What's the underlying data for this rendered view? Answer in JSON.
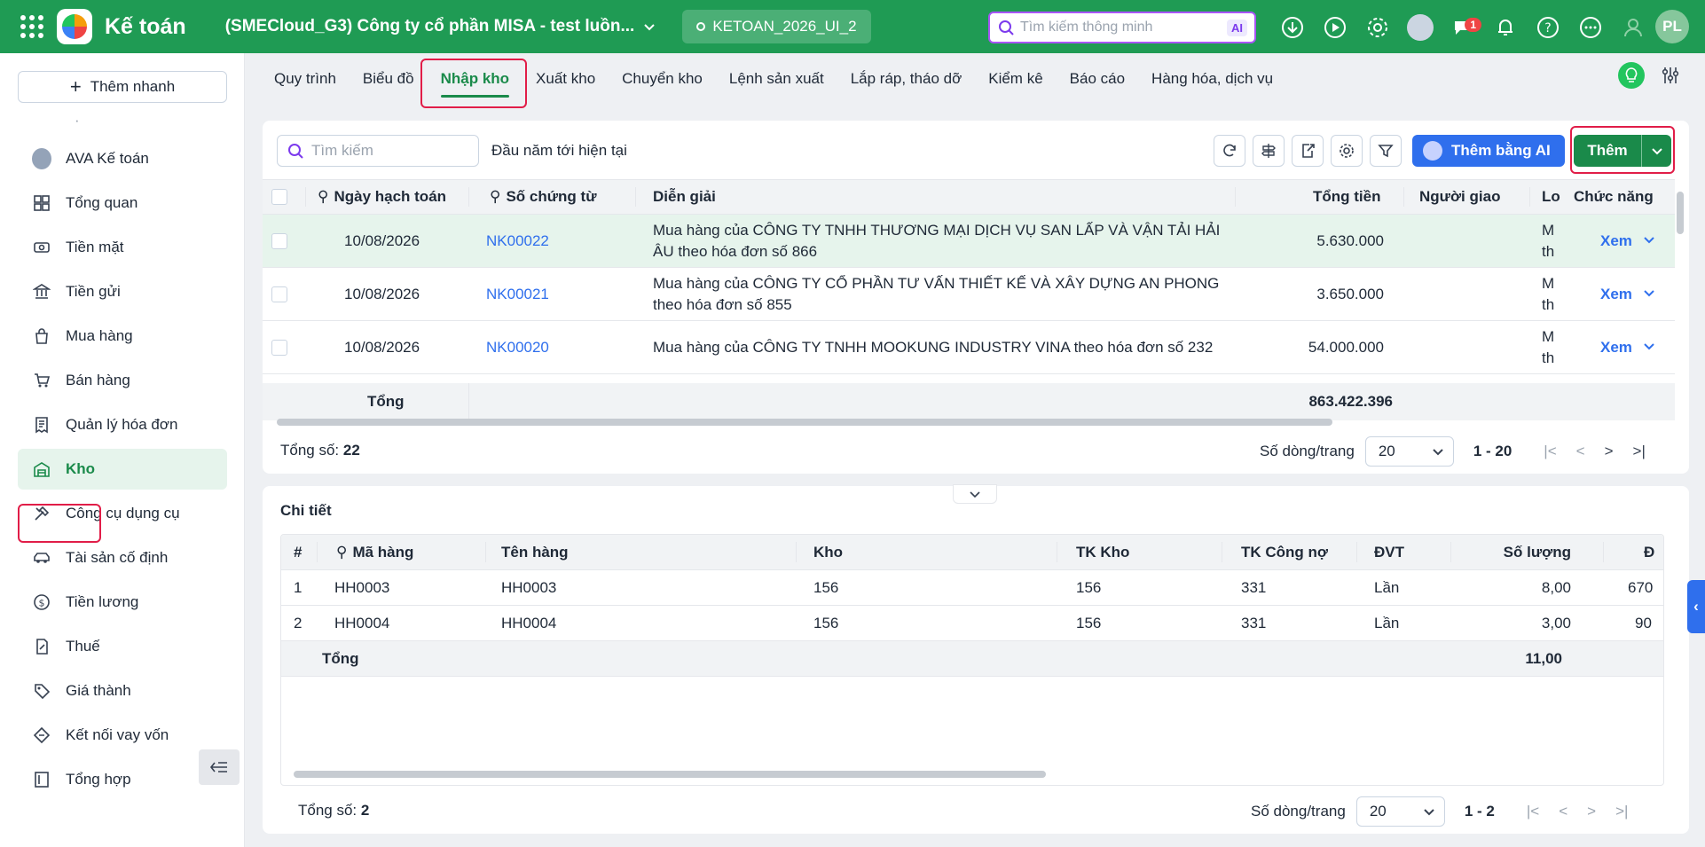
{
  "topbar": {
    "app_title": "Kế toán",
    "company": "(SMECloud_G3) Công ty cổ phần MISA - test luồn...",
    "database": "KETOAN_2026_UI_2",
    "search_placeholder": "Tìm kiếm thông minh",
    "search_ai_badge": "AI",
    "chat_badge": "1",
    "user_initials": "PL",
    "brand_color": "#1f9b54"
  },
  "sidebar": {
    "quick_add": "Thêm nhanh",
    "items": [
      {
        "label": "AVA Kế toán",
        "icon": "ava-avatar-icon"
      },
      {
        "label": "Tổng quan",
        "icon": "dashboard-icon"
      },
      {
        "label": "Tiền mặt",
        "icon": "cash-icon"
      },
      {
        "label": "Tiền gửi",
        "icon": "bank-icon"
      },
      {
        "label": "Mua hàng",
        "icon": "shopping-bag-icon"
      },
      {
        "label": "Bán hàng",
        "icon": "cart-icon"
      },
      {
        "label": "Quản lý hóa đơn",
        "icon": "invoice-icon"
      },
      {
        "label": "Kho",
        "icon": "warehouse-icon"
      },
      {
        "label": "Công cụ dụng cụ",
        "icon": "tools-icon"
      },
      {
        "label": "Tài sản cố định",
        "icon": "car-icon"
      },
      {
        "label": "Tiền lương",
        "icon": "salary-icon"
      },
      {
        "label": "Thuế",
        "icon": "tax-icon"
      },
      {
        "label": "Giá thành",
        "icon": "price-tag-icon"
      },
      {
        "label": "Kết nối vay vốn",
        "icon": "loan-icon"
      },
      {
        "label": "Tổng hợp",
        "icon": "summary-icon"
      }
    ],
    "active": "Kho"
  },
  "tabs": [
    "Quy trình",
    "Biểu đồ",
    "Nhập kho",
    "Xuất kho",
    "Chuyển kho",
    "Lệnh sản xuất",
    "Lắp ráp, tháo dỡ",
    "Kiểm kê",
    "Báo cáo",
    "Hàng hóa, dịch vụ"
  ],
  "active_tab": "Nhập kho",
  "master": {
    "search_placeholder": "Tìm kiếm",
    "period": "Đầu năm tới hiện tại",
    "ai_button": "Thêm bằng AI",
    "add_button": "Thêm",
    "columns": {
      "date": "Ngày hạch toán",
      "doc_no": "Số chứng từ",
      "desc": "Diễn giải",
      "total": "Tổng tiền",
      "deliverer": "Người giao",
      "lo": "Lo",
      "actions": "Chức năng"
    },
    "rows": [
      {
        "date": "10/08/2026",
        "doc_no": "NK00022",
        "desc": "Mua hàng của CÔNG TY TNHH THƯƠNG MẠI DỊCH VỤ SAN LẤP VÀ VẬN TẢI HẢI ÂU theo hóa đơn số 866",
        "total": "5.630.000",
        "deliverer": "",
        "lo": "M th",
        "action": "Xem"
      },
      {
        "date": "10/08/2026",
        "doc_no": "NK00021",
        "desc": "Mua hàng của CÔNG TY CỔ PHẦN TƯ VẤN THIẾT KẾ VÀ XÂY DỰNG AN PHONG theo hóa đơn số 855",
        "total": "3.650.000",
        "deliverer": "",
        "lo": "M th",
        "action": "Xem"
      },
      {
        "date": "10/08/2026",
        "doc_no": "NK00020",
        "desc": "Mua hàng của CÔNG TY TNHH MOOKUNG INDUSTRY VINA theo hóa đơn số 232",
        "total": "54.000.000",
        "deliverer": "",
        "lo": "M th",
        "action": "Xem"
      }
    ],
    "total_label": "Tổng",
    "total_value": "863.422.396",
    "count_label": "Tổng số:",
    "count_value": "22",
    "rows_per_page_label": "Số dòng/trang",
    "rows_per_page": "20",
    "range": "1 - 20"
  },
  "detail": {
    "title": "Chi tiết",
    "columns": {
      "idx": "#",
      "code": "Mã hàng",
      "name": "Tên hàng",
      "warehouse": "Kho",
      "tk_kho": "TK Kho",
      "tk_cong_no": "TK Công nợ",
      "unit": "ĐVT",
      "qty": "Số lượng",
      "price": "Đ"
    },
    "rows": [
      {
        "idx": "1",
        "code": "HH0003",
        "name": "HH0003",
        "warehouse": "156",
        "tk_kho": "156",
        "tk_cong_no": "331",
        "unit": "Lần",
        "qty": "8,00",
        "price": "670"
      },
      {
        "idx": "2",
        "code": "HH0004",
        "name": "HH0004",
        "warehouse": "156",
        "tk_kho": "156",
        "tk_cong_no": "331",
        "unit": "Lần",
        "qty": "3,00",
        "price": "90"
      }
    ],
    "total_label": "Tổng",
    "total_qty": "11,00",
    "count_label": "Tổng số:",
    "count_value": "2",
    "rows_per_page_label": "Số dòng/trang",
    "rows_per_page": "20",
    "range": "1 - 2"
  }
}
